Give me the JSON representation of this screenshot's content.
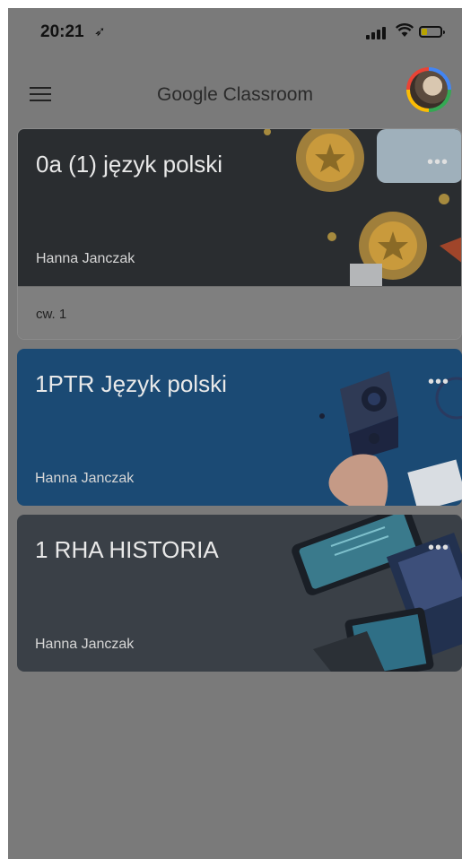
{
  "status_bar": {
    "time": "20:21",
    "location_icon": "location-arrow-icon",
    "signal_icon": "signal-icon",
    "wifi_icon": "wifi-icon",
    "battery_icon": "battery-low-icon"
  },
  "app_bar": {
    "title": "Google Classroom",
    "menu_icon": "hamburger-menu-icon"
  },
  "classes": [
    {
      "title": "0a (1) język polski",
      "teacher": "Hanna Janczak",
      "footer": "cw. 1",
      "menu": "•••",
      "color": "#2a2d30"
    },
    {
      "title": "1PTR Język polski",
      "teacher": "Hanna Janczak",
      "menu": "•••",
      "color": "#1b4a74"
    },
    {
      "title": "1 RHA HISTORIA",
      "teacher": "Hanna Janczak",
      "menu": "•••",
      "color": "#3a4047"
    }
  ]
}
